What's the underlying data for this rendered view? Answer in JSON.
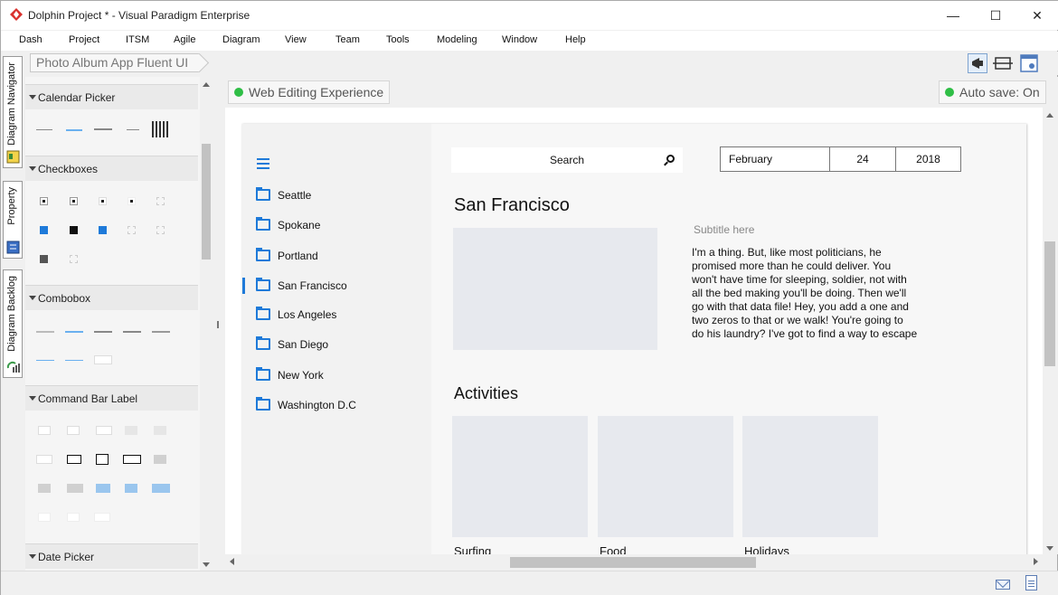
{
  "window": {
    "title": "Dolphin Project * - Visual Paradigm Enterprise",
    "minimize_glyph": "—",
    "maximize_glyph": "☐",
    "close_glyph": "✕"
  },
  "menu": [
    "Dash",
    "Project",
    "ITSM",
    "Agile",
    "Diagram",
    "View",
    "Team",
    "Tools",
    "Modeling",
    "Window",
    "Help"
  ],
  "breadcrumb": "Photo Album App Fluent UI",
  "left_tabs": [
    "Diagram Navigator",
    "Property",
    "Diagram Backlog"
  ],
  "palette": {
    "sections": [
      "Calendar Picker",
      "Checkboxes",
      "Combobox",
      "Command Bar Label",
      "Date Picker"
    ]
  },
  "canvas": {
    "diagram_tab": "Web Editing Experience",
    "autosave": "Auto save: On",
    "status_color": "#2fbe46"
  },
  "mockup": {
    "nav_items": [
      "Seattle",
      "Spokane",
      "Portland",
      "San Francisco",
      "Los Angeles",
      "San Diego",
      "New York",
      "Washington D.C"
    ],
    "selected_nav": "San Francisco",
    "search_text": "Search",
    "date": {
      "month": "February",
      "day": "24",
      "year": "2018"
    },
    "heading": "San Francisco",
    "subtitle": "Subtitle here",
    "body_lines": [
      "I'm a thing. But, like most politicians, he",
      "promised more than he could deliver. You",
      "won't have time for sleeping, soldier, not with",
      "all the bed making you'll be doing. Then we'll",
      "go with that data file! Hey, you add a one and",
      "two zeros to that or we walk! You're going to",
      "do his laundry? I've got to find a way to escape"
    ],
    "activities_heading": "Activities",
    "activities": [
      "Surfing",
      "Food",
      "Holidays"
    ],
    "accent_color": "#1e7ad9"
  }
}
